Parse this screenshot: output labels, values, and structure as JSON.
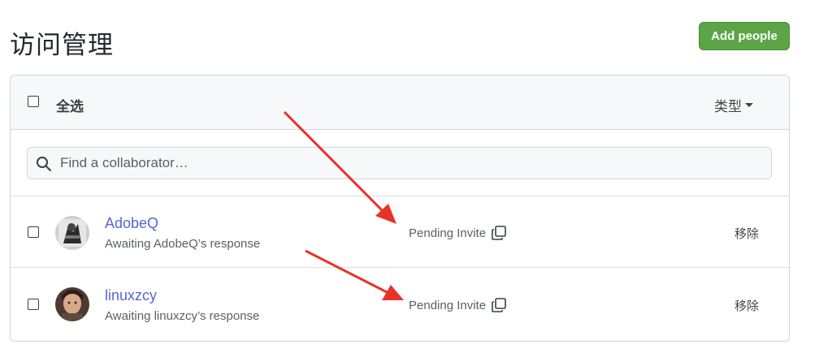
{
  "page": {
    "title": "访问管理",
    "add_people_label": "Add people"
  },
  "header": {
    "select_all_label": "全选",
    "type_filter_label": "类型"
  },
  "search": {
    "placeholder": "Find a collaborator…"
  },
  "collaborators": [
    {
      "username": "AdobeQ",
      "status_text": "Awaiting AdobeQ’s response",
      "invite_status": "Pending Invite",
      "remove_label": "移除"
    },
    {
      "username": "linuxzcy",
      "status_text": "Awaiting linuxzcy’s response",
      "invite_status": "Pending Invite",
      "remove_label": "移除"
    }
  ],
  "colors": {
    "add_button": "#5ca446",
    "username_link": "#5a63d8",
    "annotation_arrow": "#e8322a"
  },
  "icons": [
    "search-icon",
    "copy-icon",
    "chevron-down-icon"
  ]
}
